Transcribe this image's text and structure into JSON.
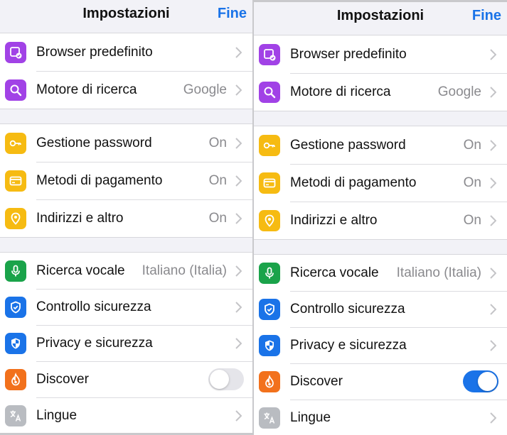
{
  "colors": {
    "accent": "#1a73e8",
    "purple": "#a142e6",
    "yellow": "#f6bb12",
    "green": "#1aa34a",
    "orange": "#f2711c",
    "grey": "#b9bcc1"
  },
  "left": {
    "title": "Impostazioni",
    "done_label": "Fine",
    "rows": {
      "default_browser": {
        "label": "Browser predefinito",
        "icon": "browser-check-icon"
      },
      "search_engine": {
        "label": "Motore di ricerca",
        "value": "Google",
        "icon": "search-icon"
      },
      "passwords": {
        "label": "Gestione password",
        "value": "On",
        "icon": "key-icon"
      },
      "payments": {
        "label": "Metodi di pagamento",
        "value": "On",
        "icon": "credit-card-icon"
      },
      "addresses": {
        "label": "Indirizzi e altro",
        "value": "On",
        "icon": "location-pin-icon"
      },
      "voice_search": {
        "label": "Ricerca vocale",
        "value": "Italiano (Italia)",
        "icon": "microphone-icon"
      },
      "safety_check": {
        "label": "Controllo sicurezza",
        "icon": "shield-check-icon"
      },
      "privacy": {
        "label": "Privacy e sicurezza",
        "icon": "shield-icon"
      },
      "discover": {
        "label": "Discover",
        "toggle": false,
        "icon": "flame-icon"
      },
      "languages": {
        "label": "Lingue",
        "icon": "translate-icon"
      }
    }
  },
  "right": {
    "title": "Impostazioni",
    "done_label": "Fine",
    "rows": {
      "default_browser": {
        "label": "Browser predefinito",
        "icon": "browser-check-icon"
      },
      "search_engine": {
        "label": "Motore di ricerca",
        "value": "Google",
        "icon": "search-icon"
      },
      "passwords": {
        "label": "Gestione password",
        "value": "On",
        "icon": "key-icon"
      },
      "payments": {
        "label": "Metodi di pagamento",
        "value": "On",
        "icon": "credit-card-icon"
      },
      "addresses": {
        "label": "Indirizzi e altro",
        "value": "On",
        "icon": "location-pin-icon"
      },
      "voice_search": {
        "label": "Ricerca vocale",
        "value": "Italiano (Italia)",
        "icon": "microphone-icon"
      },
      "safety_check": {
        "label": "Controllo sicurezza",
        "icon": "shield-check-icon"
      },
      "privacy": {
        "label": "Privacy e sicurezza",
        "icon": "shield-icon"
      },
      "discover": {
        "label": "Discover",
        "toggle": true,
        "icon": "flame-icon"
      },
      "languages": {
        "label": "Lingue",
        "icon": "translate-icon"
      }
    }
  }
}
